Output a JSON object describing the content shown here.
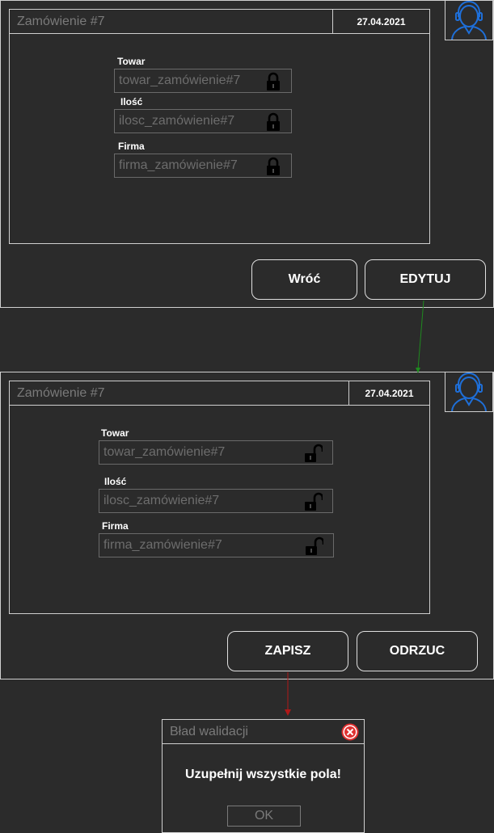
{
  "screen1": {
    "title": "Zamówienie #7",
    "date": "27.04.2021",
    "fields": [
      {
        "label": "Towar",
        "value": "towar_zamówienie#7",
        "lock": "lock-closed-icon"
      },
      {
        "label": "Ilość",
        "value": "ilosc_zamówienie#7",
        "lock": "lock-closed-icon"
      },
      {
        "label": "Firma",
        "value": "firma_zamówienie#7",
        "lock": "lock-closed-icon"
      }
    ],
    "buttons": {
      "back": "Wróć",
      "edit": "EDYTUJ"
    }
  },
  "screen2": {
    "title": "Zamówienie #7",
    "date": "27.04.2021",
    "fields": [
      {
        "label": "Towar",
        "value": "towar_zamówienie#7",
        "lock": "lock-open-icon"
      },
      {
        "label": "Ilość",
        "value": "ilosc_zamówienie#7",
        "lock": "lock-open-icon"
      },
      {
        "label": "Firma",
        "value": "firma_zamówienie#7",
        "lock": "lock-open-icon"
      }
    ],
    "buttons": {
      "save": "ZAPISZ",
      "reject": "ODRZUC"
    }
  },
  "dialog": {
    "title": "Bład walidacji",
    "message": "Uzupełnij wszystkie pola!",
    "ok": "OK",
    "close_icon": "close-circle-icon"
  },
  "colors": {
    "background": "#2b2b2b",
    "avatar": "#1e6fd9",
    "arrow_success": "#1f8a1f",
    "arrow_error": "#b01818",
    "close_icon": "#e03030"
  },
  "icons": {
    "avatar": "user-headset-icon"
  }
}
